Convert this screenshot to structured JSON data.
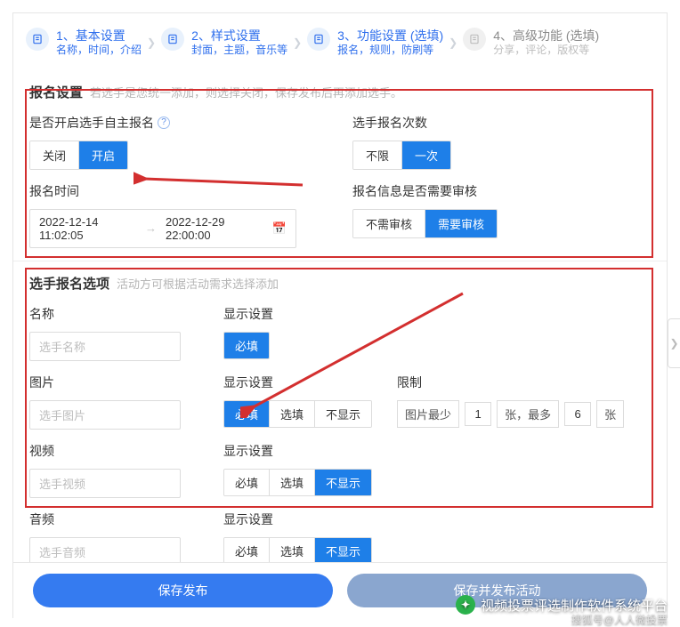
{
  "steps": [
    {
      "title": "1、基本设置",
      "sub": "名称，时间，介绍"
    },
    {
      "title": "2、样式设置",
      "sub": "封面，主题，音乐等"
    },
    {
      "title": "3、功能设置 (选填)",
      "sub": "报名，规则，防刷等"
    },
    {
      "title": "4、高级功能 (选填)",
      "sub": "分享，评论，版权等"
    }
  ],
  "reg": {
    "title": "报名设置",
    "hint": "若选手是您统一添加，则选择关闭，保存发布后再添加选手。",
    "self_label": "是否开启选手自主报名",
    "self": {
      "off": "关闭",
      "on": "开启"
    },
    "times_label": "选手报名次数",
    "times": {
      "unlimited": "不限",
      "once": "一次"
    },
    "time_label": "报名时间",
    "date_start": "2022-12-14 11:02:05",
    "date_end": "2022-12-29 22:00:00",
    "audit_label": "报名信息是否需要审核",
    "audit": {
      "no": "不需审核",
      "yes": "需要审核"
    }
  },
  "opts": {
    "title": "选手报名选项",
    "hint": "活动方可根据活动需求选择添加",
    "name_label": "名称",
    "name_ph": "选手名称",
    "pic_label": "图片",
    "pic_ph": "选手图片",
    "video_label": "视频",
    "video_ph": "选手视频",
    "audio_label": "音频",
    "audio_ph": "选手音频",
    "disp_label": "显示设置",
    "required": "必填",
    "optional": "选填",
    "hidden": "不显示",
    "limit_label": "限制",
    "limit_min_lbl": "图片最少",
    "limit_min": "1",
    "limit_mid": "张，最多",
    "limit_max": "6",
    "limit_end": "张"
  },
  "actions": {
    "save_pub": "保存发布",
    "save_draft": "保存并发布活动"
  },
  "watermark": {
    "title": "视频投票评选制作软件系统平台",
    "sub": "搜狐号@人人微投票"
  }
}
